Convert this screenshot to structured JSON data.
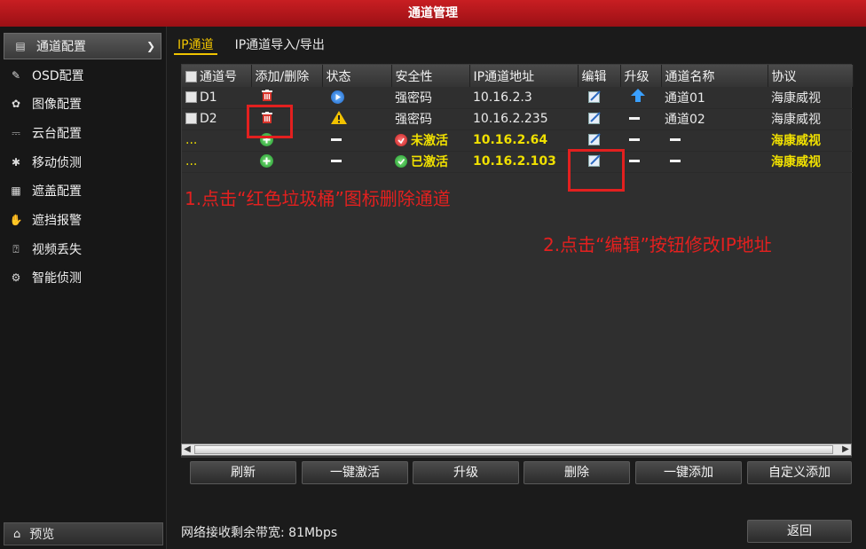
{
  "window": {
    "title": "通道管理"
  },
  "sidebar": {
    "items": [
      {
        "label": "通道配置",
        "icon": "camera-icon",
        "active": true
      },
      {
        "label": "OSD配置",
        "icon": "pencil-icon"
      },
      {
        "label": "图像配置",
        "icon": "palette-icon"
      },
      {
        "label": "云台配置",
        "icon": "ptz-icon"
      },
      {
        "label": "移动侦测",
        "icon": "motion-icon"
      },
      {
        "label": "遮盖配置",
        "icon": "mask-icon"
      },
      {
        "label": "遮挡报警",
        "icon": "hand-icon"
      },
      {
        "label": "视频丢失",
        "icon": "question-icon"
      },
      {
        "label": "智能侦测",
        "icon": "smart-icon"
      }
    ],
    "preview_label": "预览"
  },
  "tabs": [
    {
      "label": "IP通道",
      "active": true
    },
    {
      "label": "IP通道导入/导出"
    }
  ],
  "table": {
    "headers": [
      "通道号",
      "添加/删除",
      "状态",
      "安全性",
      "IP通道地址",
      "编辑",
      "升级",
      "通道名称",
      "协议"
    ],
    "rows": [
      {
        "channel": "D1",
        "action": "trash",
        "status": "play",
        "security": "强密码",
        "ip": "10.16.2.3",
        "upgrade": "up",
        "name": "通道01",
        "protocol": "海康威视"
      },
      {
        "channel": "D2",
        "action": "trash",
        "status": "warn",
        "security": "强密码",
        "ip": "10.16.2.235",
        "upgrade": "dash",
        "name": "通道02",
        "protocol": "海康威视"
      },
      {
        "channel": "...",
        "action": "add",
        "status": "dash",
        "security": "未激活",
        "security_state": "inactive",
        "ip": "10.16.2.64",
        "upgrade": "dash",
        "name": "—",
        "protocol": "海康威视"
      },
      {
        "channel": "...",
        "action": "add",
        "status": "dash",
        "security": "已激活",
        "security_state": "active",
        "ip": "10.16.2.103",
        "upgrade": "dash",
        "name": "—",
        "protocol": "海康威视"
      }
    ]
  },
  "buttons": {
    "refresh": "刷新",
    "activate_all": "一键激活",
    "upgrade": "升级",
    "delete": "删除",
    "add_all": "一键添加",
    "custom_add": "自定义添加",
    "back": "返回"
  },
  "footer": {
    "bandwidth": "网络接收剩余带宽: 81Mbps"
  },
  "annotations": {
    "step1": "1.点击“红色垃圾桶”图标删除通道",
    "step2": "2.点击“编辑”按钮修改IP地址"
  },
  "colors": {
    "title_bar": "#b5161b",
    "tab_active": "#f0c400",
    "annotation": "#e3201f",
    "new_row_text": "#f0e000"
  }
}
